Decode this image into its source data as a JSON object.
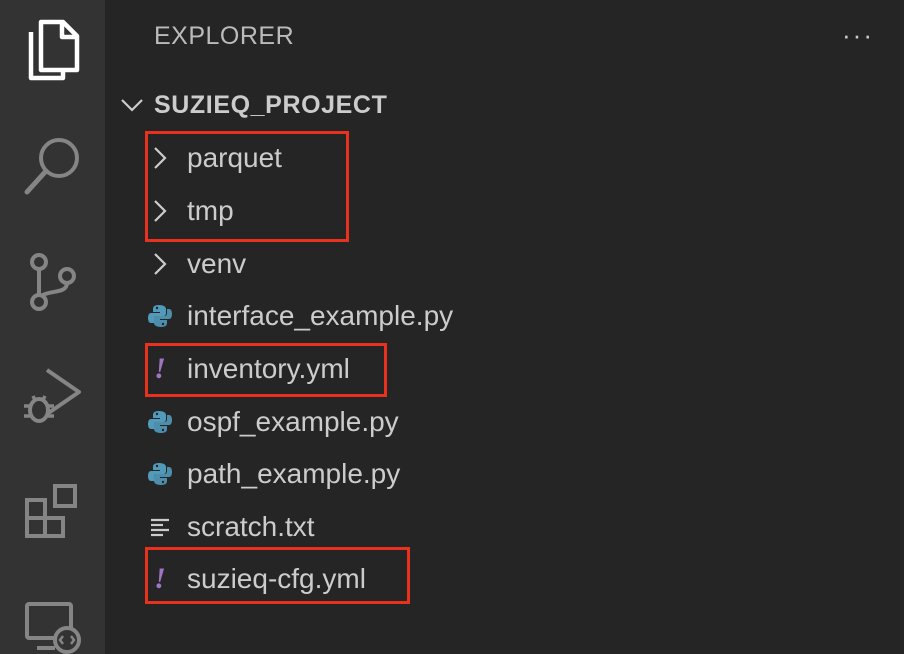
{
  "sidebar": {
    "title": "EXPLORER",
    "more_actions": "···",
    "project": {
      "name": "SUZIEQ_PROJECT",
      "items": [
        {
          "label": "parquet",
          "type": "folder",
          "icon": "chevron-right-icon",
          "highlighted": true
        },
        {
          "label": "tmp",
          "type": "folder",
          "icon": "chevron-right-icon",
          "highlighted": true
        },
        {
          "label": "venv",
          "type": "folder",
          "icon": "chevron-right-icon",
          "highlighted": false
        },
        {
          "label": "interface_example.py",
          "type": "python",
          "icon": "python-file-icon",
          "highlighted": false
        },
        {
          "label": "inventory.yml",
          "type": "yaml",
          "icon": "yaml-file-icon",
          "highlighted": true
        },
        {
          "label": "ospf_example.py",
          "type": "python",
          "icon": "python-file-icon",
          "highlighted": false
        },
        {
          "label": "path_example.py",
          "type": "python",
          "icon": "python-file-icon",
          "highlighted": false
        },
        {
          "label": "scratch.txt",
          "type": "text",
          "icon": "text-file-icon",
          "highlighted": false
        },
        {
          "label": "suzieq-cfg.yml",
          "type": "yaml",
          "icon": "yaml-file-icon",
          "highlighted": true
        }
      ]
    }
  },
  "colors": {
    "activity_bar": "#333333",
    "sidebar_bg": "#252526",
    "highlight": "#e8321e",
    "python_icon": "#519aba",
    "yaml_icon": "#a074c4"
  }
}
